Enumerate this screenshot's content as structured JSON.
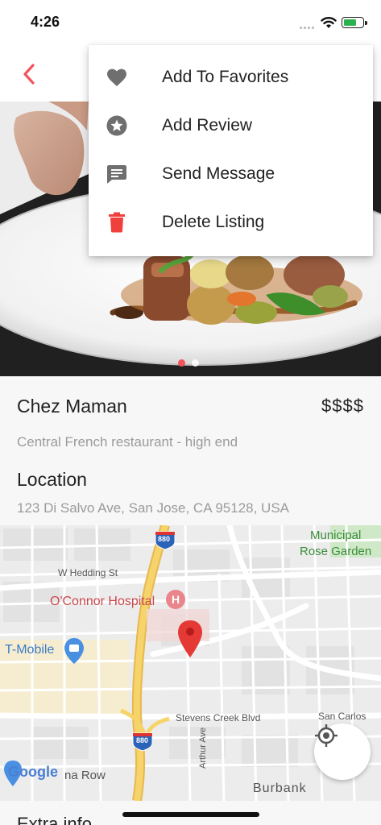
{
  "status_bar": {
    "time": "4:26"
  },
  "menu": {
    "items": [
      {
        "label": "Add To Favorites",
        "icon": "heart-icon"
      },
      {
        "label": "Add Review",
        "icon": "star-circle-icon"
      },
      {
        "label": "Send Message",
        "icon": "message-icon"
      },
      {
        "label": "Delete Listing",
        "icon": "trash-icon"
      }
    ]
  },
  "gallery": {
    "page_count": 2,
    "active_index": 0
  },
  "listing": {
    "name": "Chez Maman",
    "price": "$$$$",
    "description": "Central French restaurant - high end",
    "location_title": "Location",
    "address": "123 Di Salvo Ave, San Jose, CA 95128, USA"
  },
  "map": {
    "labels": {
      "municipal_line1": "Municipal",
      "municipal_line2": "Rose Garden",
      "w_hedding": "W Hedding St",
      "hospital": "O'Connor Hospital",
      "tmobile": "T-Mobile",
      "stevens_creek": "Stevens Creek Blvd",
      "san_carlos": "San Carlos",
      "arthur_ave": "Arthur Ave",
      "burbank": "Burbank",
      "google": "Google",
      "na_row": "na Row",
      "highway_top": "880",
      "highway_bottom": "880"
    }
  },
  "extra_info_title": "Extra info",
  "colors": {
    "accent": "#f2545b",
    "menu_icon": "#6f6f6f",
    "delete_icon": "#f0403c",
    "pin": "#e53935",
    "highway": "#f7d36b"
  }
}
